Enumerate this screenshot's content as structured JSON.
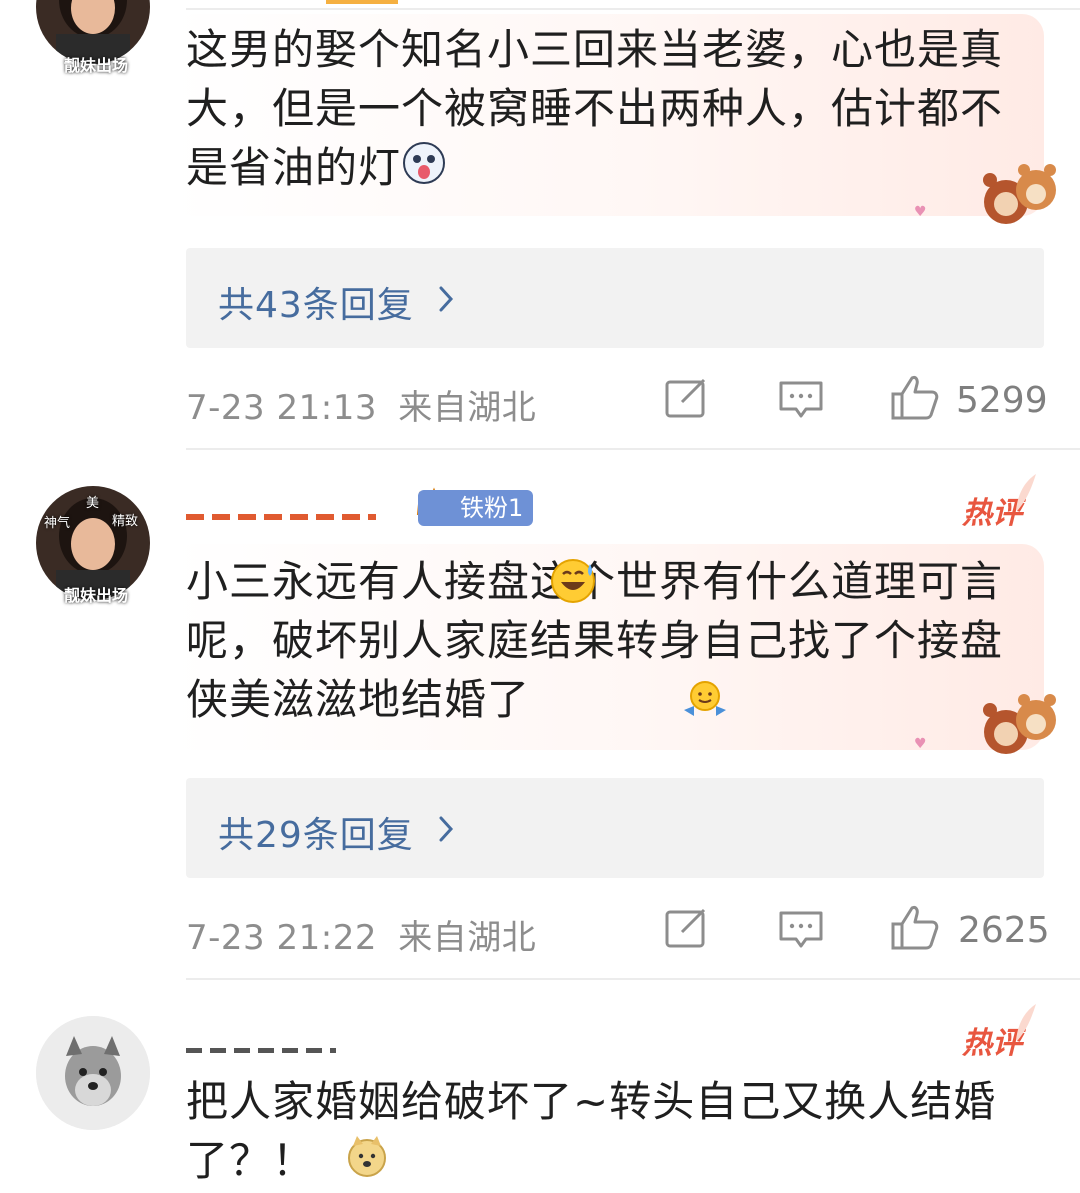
{
  "comments": [
    {
      "text": "这男的娶个知名小三回来当老婆，心也是真大，但是一个被窝睡不出两种人，估计都不是省油的灯",
      "replies_label": "共43条回复",
      "time": "7-23 21:13",
      "location": "来自湖北",
      "likes": "5299",
      "avatar_caption": "靓妹出场"
    },
    {
      "badge": "铁粉1",
      "hot_label": "热评",
      "text": "小三永远有人接盘这个世界有什么道理可言呢，破坏别人家庭结果转身自己找了个接盘侠美滋滋地结婚了",
      "replies_label": "共29条回复",
      "time": "7-23 21:22",
      "location": "来自湖北",
      "likes": "2625",
      "avatar_caption": "靓妹出场",
      "avatar_tags": [
        "神气",
        "美",
        "精致"
      ]
    },
    {
      "hot_label": "热评",
      "text": "把人家婚姻给破坏了~转头自己又换人结婚了？！"
    }
  ],
  "colors": {
    "link_blue": "#466c9e",
    "meta_gray": "#8d8d8d",
    "hot_red": "#e8563f",
    "fan_badge": "#6e91d6"
  },
  "icons": [
    "reply-icon",
    "comment-icon",
    "thumbs-up-icon",
    "chevron-right-icon"
  ]
}
